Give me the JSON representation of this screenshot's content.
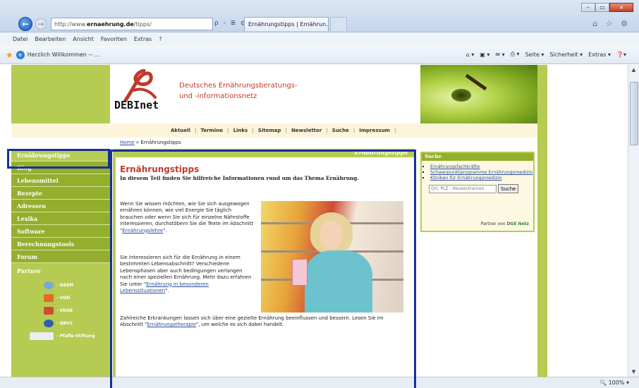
{
  "browser": {
    "address_prefix": "http://www.",
    "address_domain": "ernaehrung.de",
    "address_suffix": "/tipps/",
    "address_tools": "ρ - ≣ ¢ ×",
    "tab_title": "Ernährungstipps | Ernährun...",
    "tab_close": "×",
    "back_glyph": "←",
    "forward_glyph": "→",
    "window_controls": [
      "–",
      "▭",
      "×"
    ],
    "right_icons": "⌂ ☆ ⚙",
    "menu": [
      "Datei",
      "Bearbeiten",
      "Ansicht",
      "Favoriten",
      "Extras",
      "?"
    ],
    "favorite_link": "Herzlich Willkommen -- ...",
    "command_bar": [
      "Seite ▾",
      "Sicherheit ▾",
      "Extras ▾"
    ],
    "zoom": "100%"
  },
  "site": {
    "logo_text": "DEBInet",
    "title_line1": "Deutsches Ernährungsberatungs-",
    "title_line2": "und -informationsnetz",
    "topnav": [
      "Aktuell",
      "Termine",
      "Links",
      "Sitemap",
      "Newsletter",
      "Suche",
      "Impressum"
    ],
    "breadcrumb_home": "Home",
    "breadcrumb_sep": " » ",
    "breadcrumb_current": "Ernährungstipps"
  },
  "sidebar": {
    "items": [
      {
        "label": "Ernährungstipps"
      },
      {
        "label": "Blog"
      },
      {
        "label": "Lebensmittel"
      },
      {
        "label": "Rezepte"
      },
      {
        "label": "Adressen"
      },
      {
        "label": "Lexika"
      },
      {
        "label": "Software"
      },
      {
        "label": "Berechnungstools"
      },
      {
        "label": "Forum"
      }
    ],
    "partner_title": "Partner",
    "partners": [
      {
        "label": "- DAEM",
        "color": "#7aa6d9"
      },
      {
        "label": "- VDD",
        "color": "#e06b2a"
      },
      {
        "label": "- VDOE",
        "color": "#d14b34"
      },
      {
        "label": "- QBVS",
        "color": "#2a5fae"
      },
      {
        "label": "- Pfaffe-Stiftung",
        "color": "#e9eef6"
      }
    ]
  },
  "main": {
    "banner": "Ernährungstipps",
    "title": "Ernährungstipps",
    "intro": "In diesem Teil finden Sie hilfreiche Informationen rund um das Thema Ernährung.",
    "para1_text": "Wenn Sie wissen möchten, wie Sie sich ausgewogen ernähren können, wie viel Energie Sie täglich brauchen oder wenn Sie sich für einzelne Nährstoffe interessieren, durchstöbern Sie die Texte im Abschnitt \"",
    "para1_link": "Ernährungslehre",
    "para1_end": "\".",
    "para2_text": "Sie interessieren sich für die Ernährung in einem bestimmten Lebensabschnitt? Verschiedene Lebensphasen aber auch bedingungen verlangen nach einer speziellen Ernährung. Mehr dazu erfahren Sie unter \"",
    "para2_link": "Ernährung in besonderen Lebenssituationen",
    "para2_end": "\".",
    "para3_text": "Zahlreiche Erkrankungen lassen sich über eine gezielte Ernährung beeinflussen und bessern. Lesen Sie im Abschnitt \"",
    "para3_link": "Ernährungstherapie",
    "para3_end": "\", um welche es sich dabei handelt."
  },
  "search_box": {
    "title": "Suche",
    "links": [
      "Ernährungsfachkräfte",
      "Schwerpunktprogramme Ernährungsmedizin",
      "Kliniken für Ernährungsmedizin"
    ],
    "placeholder": "Ort, PLZ - Heusentrarnen",
    "button": "Suche",
    "partner_label": "Partner von",
    "partner_name": "DGE Netz"
  },
  "colors": {
    "accent_green": "#b6cb51",
    "sidebar_item_green": "#94ae2e",
    "title_red": "#c0392b",
    "link_blue": "#2850a0",
    "highlight_blue": "#17309a"
  }
}
